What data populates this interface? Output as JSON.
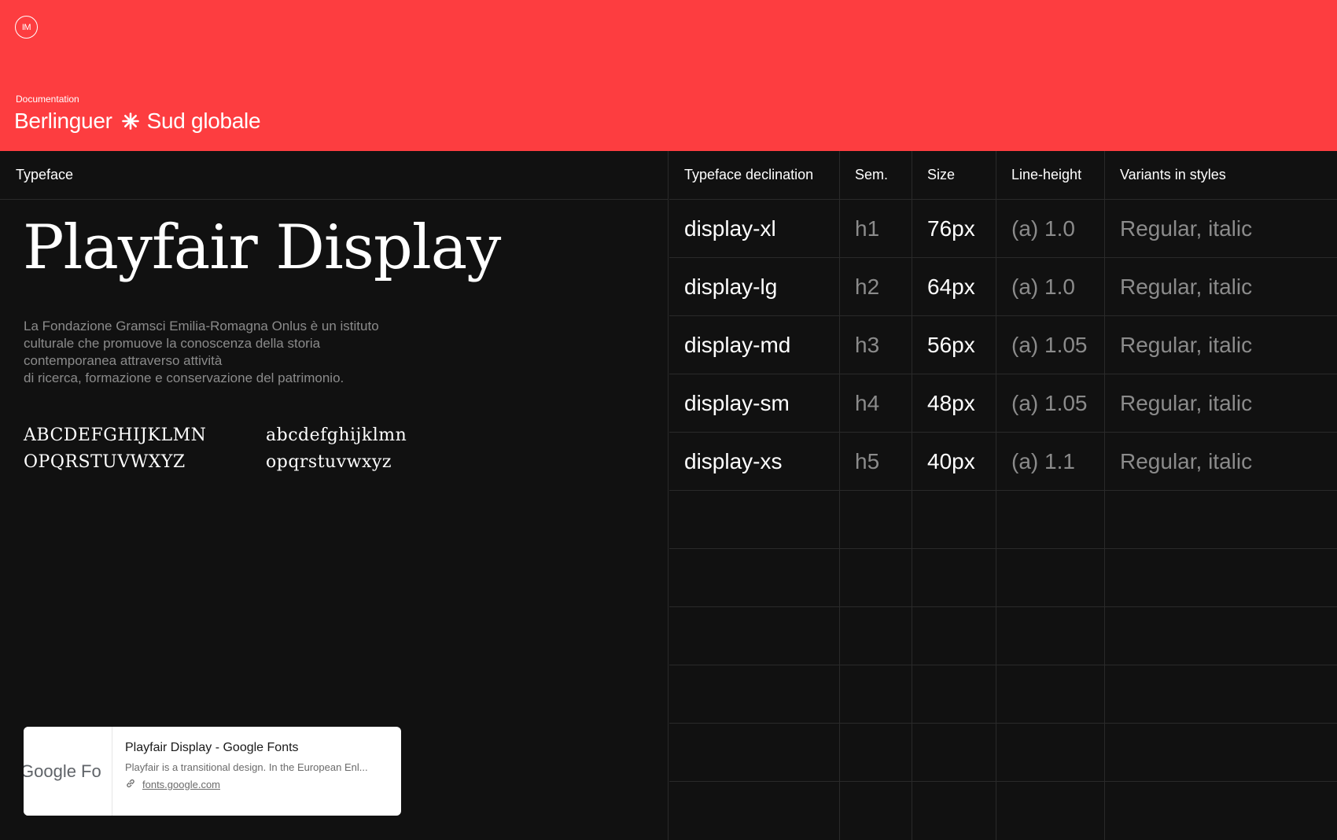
{
  "header": {
    "logo_text": "IM",
    "section": "Documentation",
    "title_left": "Berlinguer",
    "title_right": "Sud globale",
    "background": "#fd3d40"
  },
  "typeface_panel": {
    "heading": "Typeface",
    "font_name": "Playfair Display",
    "description": "La Fondazione Gramsci Emilia-Romagna Onlus è un istituto\nculturale che promuove la conoscenza della storia\ncontemporanea attraverso attività\ndi ricerca, formazione e conservazione del patrimonio.",
    "uppercase": "ABCDEFGHIJKLMN\nOPQRSTUVWXYZ",
    "lowercase": "abcdefghijklmn\nopqrstuvwxyz"
  },
  "link_card": {
    "thumb_text": "Google Fo",
    "title": "Playfair Display - Google Fonts",
    "description": "Playfair is a transitional design. In the European Enl...",
    "url": "fonts.google.com"
  },
  "table": {
    "headers": [
      "Typeface declination",
      "Sem.",
      "Size",
      "Line-height",
      "Variants in styles"
    ],
    "rows": [
      {
        "name": "display-xl",
        "sem": "h1",
        "size": "76px",
        "line_height": "(a) 1.0",
        "variants": "Regular, italic"
      },
      {
        "name": "display-lg",
        "sem": "h2",
        "size": "64px",
        "line_height": "(a) 1.0",
        "variants": "Regular, italic"
      },
      {
        "name": "display-md",
        "sem": "h3",
        "size": "56px",
        "line_height": "(a) 1.05",
        "variants": "Regular, italic"
      },
      {
        "name": "display-sm",
        "sem": "h4",
        "size": "48px",
        "line_height": "(a) 1.05",
        "variants": "Regular, italic"
      },
      {
        "name": "display-xs",
        "sem": "h5",
        "size": "40px",
        "line_height": "(a) 1.1",
        "variants": "Regular, italic"
      }
    ]
  }
}
